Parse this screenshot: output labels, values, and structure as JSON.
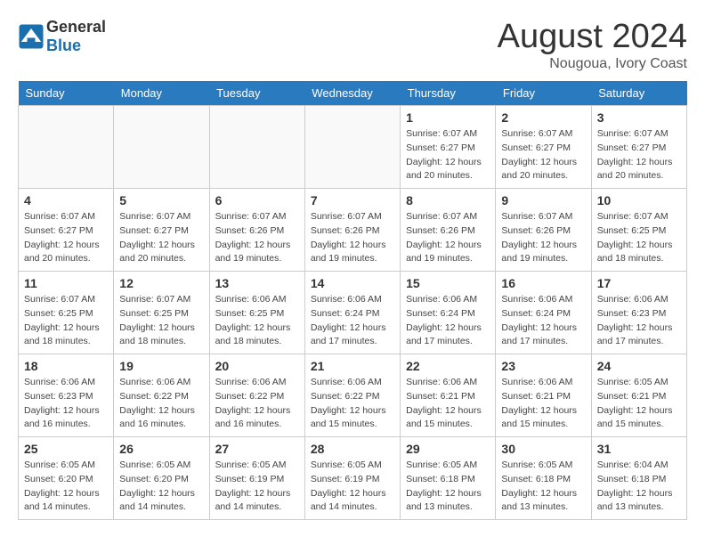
{
  "header": {
    "logo_general": "General",
    "logo_blue": "Blue",
    "month_year": "August 2024",
    "location": "Nougoua, Ivory Coast"
  },
  "weekdays": [
    "Sunday",
    "Monday",
    "Tuesday",
    "Wednesday",
    "Thursday",
    "Friday",
    "Saturday"
  ],
  "weeks": [
    [
      {
        "day": "",
        "info": ""
      },
      {
        "day": "",
        "info": ""
      },
      {
        "day": "",
        "info": ""
      },
      {
        "day": "",
        "info": ""
      },
      {
        "day": "1",
        "info": "Sunrise: 6:07 AM\nSunset: 6:27 PM\nDaylight: 12 hours\nand 20 minutes."
      },
      {
        "day": "2",
        "info": "Sunrise: 6:07 AM\nSunset: 6:27 PM\nDaylight: 12 hours\nand 20 minutes."
      },
      {
        "day": "3",
        "info": "Sunrise: 6:07 AM\nSunset: 6:27 PM\nDaylight: 12 hours\nand 20 minutes."
      }
    ],
    [
      {
        "day": "4",
        "info": "Sunrise: 6:07 AM\nSunset: 6:27 PM\nDaylight: 12 hours\nand 20 minutes."
      },
      {
        "day": "5",
        "info": "Sunrise: 6:07 AM\nSunset: 6:27 PM\nDaylight: 12 hours\nand 20 minutes."
      },
      {
        "day": "6",
        "info": "Sunrise: 6:07 AM\nSunset: 6:26 PM\nDaylight: 12 hours\nand 19 minutes."
      },
      {
        "day": "7",
        "info": "Sunrise: 6:07 AM\nSunset: 6:26 PM\nDaylight: 12 hours\nand 19 minutes."
      },
      {
        "day": "8",
        "info": "Sunrise: 6:07 AM\nSunset: 6:26 PM\nDaylight: 12 hours\nand 19 minutes."
      },
      {
        "day": "9",
        "info": "Sunrise: 6:07 AM\nSunset: 6:26 PM\nDaylight: 12 hours\nand 19 minutes."
      },
      {
        "day": "10",
        "info": "Sunrise: 6:07 AM\nSunset: 6:25 PM\nDaylight: 12 hours\nand 18 minutes."
      }
    ],
    [
      {
        "day": "11",
        "info": "Sunrise: 6:07 AM\nSunset: 6:25 PM\nDaylight: 12 hours\nand 18 minutes."
      },
      {
        "day": "12",
        "info": "Sunrise: 6:07 AM\nSunset: 6:25 PM\nDaylight: 12 hours\nand 18 minutes."
      },
      {
        "day": "13",
        "info": "Sunrise: 6:06 AM\nSunset: 6:25 PM\nDaylight: 12 hours\nand 18 minutes."
      },
      {
        "day": "14",
        "info": "Sunrise: 6:06 AM\nSunset: 6:24 PM\nDaylight: 12 hours\nand 17 minutes."
      },
      {
        "day": "15",
        "info": "Sunrise: 6:06 AM\nSunset: 6:24 PM\nDaylight: 12 hours\nand 17 minutes."
      },
      {
        "day": "16",
        "info": "Sunrise: 6:06 AM\nSunset: 6:24 PM\nDaylight: 12 hours\nand 17 minutes."
      },
      {
        "day": "17",
        "info": "Sunrise: 6:06 AM\nSunset: 6:23 PM\nDaylight: 12 hours\nand 17 minutes."
      }
    ],
    [
      {
        "day": "18",
        "info": "Sunrise: 6:06 AM\nSunset: 6:23 PM\nDaylight: 12 hours\nand 16 minutes."
      },
      {
        "day": "19",
        "info": "Sunrise: 6:06 AM\nSunset: 6:22 PM\nDaylight: 12 hours\nand 16 minutes."
      },
      {
        "day": "20",
        "info": "Sunrise: 6:06 AM\nSunset: 6:22 PM\nDaylight: 12 hours\nand 16 minutes."
      },
      {
        "day": "21",
        "info": "Sunrise: 6:06 AM\nSunset: 6:22 PM\nDaylight: 12 hours\nand 15 minutes."
      },
      {
        "day": "22",
        "info": "Sunrise: 6:06 AM\nSunset: 6:21 PM\nDaylight: 12 hours\nand 15 minutes."
      },
      {
        "day": "23",
        "info": "Sunrise: 6:06 AM\nSunset: 6:21 PM\nDaylight: 12 hours\nand 15 minutes."
      },
      {
        "day": "24",
        "info": "Sunrise: 6:05 AM\nSunset: 6:21 PM\nDaylight: 12 hours\nand 15 minutes."
      }
    ],
    [
      {
        "day": "25",
        "info": "Sunrise: 6:05 AM\nSunset: 6:20 PM\nDaylight: 12 hours\nand 14 minutes."
      },
      {
        "day": "26",
        "info": "Sunrise: 6:05 AM\nSunset: 6:20 PM\nDaylight: 12 hours\nand 14 minutes."
      },
      {
        "day": "27",
        "info": "Sunrise: 6:05 AM\nSunset: 6:19 PM\nDaylight: 12 hours\nand 14 minutes."
      },
      {
        "day": "28",
        "info": "Sunrise: 6:05 AM\nSunset: 6:19 PM\nDaylight: 12 hours\nand 14 minutes."
      },
      {
        "day": "29",
        "info": "Sunrise: 6:05 AM\nSunset: 6:18 PM\nDaylight: 12 hours\nand 13 minutes."
      },
      {
        "day": "30",
        "info": "Sunrise: 6:05 AM\nSunset: 6:18 PM\nDaylight: 12 hours\nand 13 minutes."
      },
      {
        "day": "31",
        "info": "Sunrise: 6:04 AM\nSunset: 6:18 PM\nDaylight: 12 hours\nand 13 minutes."
      }
    ]
  ]
}
